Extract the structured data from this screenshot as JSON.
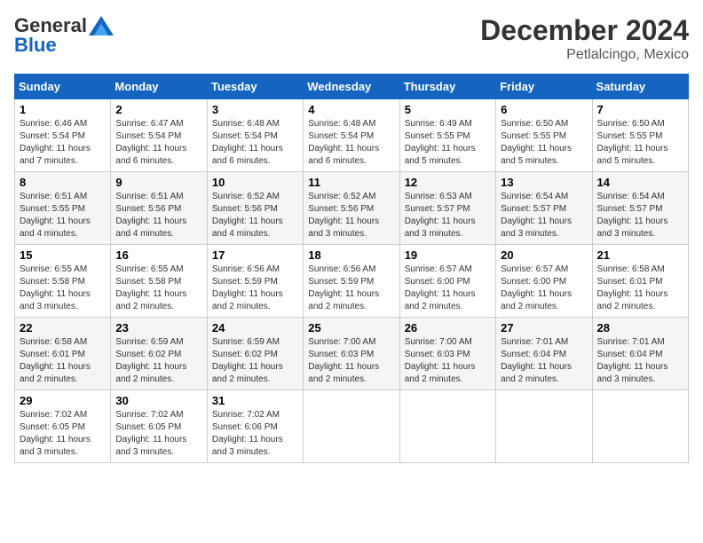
{
  "header": {
    "logo_general": "General",
    "logo_blue": "Blue",
    "month_title": "December 2024",
    "location": "Petlalcingo, Mexico"
  },
  "weekdays": [
    "Sunday",
    "Monday",
    "Tuesday",
    "Wednesday",
    "Thursday",
    "Friday",
    "Saturday"
  ],
  "weeks": [
    [
      {
        "day": "1",
        "info": "Sunrise: 6:46 AM\nSunset: 5:54 PM\nDaylight: 11 hours and 7 minutes."
      },
      {
        "day": "2",
        "info": "Sunrise: 6:47 AM\nSunset: 5:54 PM\nDaylight: 11 hours and 6 minutes."
      },
      {
        "day": "3",
        "info": "Sunrise: 6:48 AM\nSunset: 5:54 PM\nDaylight: 11 hours and 6 minutes."
      },
      {
        "day": "4",
        "info": "Sunrise: 6:48 AM\nSunset: 5:54 PM\nDaylight: 11 hours and 6 minutes."
      },
      {
        "day": "5",
        "info": "Sunrise: 6:49 AM\nSunset: 5:55 PM\nDaylight: 11 hours and 5 minutes."
      },
      {
        "day": "6",
        "info": "Sunrise: 6:50 AM\nSunset: 5:55 PM\nDaylight: 11 hours and 5 minutes."
      },
      {
        "day": "7",
        "info": "Sunrise: 6:50 AM\nSunset: 5:55 PM\nDaylight: 11 hours and 5 minutes."
      }
    ],
    [
      {
        "day": "8",
        "info": "Sunrise: 6:51 AM\nSunset: 5:55 PM\nDaylight: 11 hours and 4 minutes."
      },
      {
        "day": "9",
        "info": "Sunrise: 6:51 AM\nSunset: 5:56 PM\nDaylight: 11 hours and 4 minutes."
      },
      {
        "day": "10",
        "info": "Sunrise: 6:52 AM\nSunset: 5:56 PM\nDaylight: 11 hours and 4 minutes."
      },
      {
        "day": "11",
        "info": "Sunrise: 6:52 AM\nSunset: 5:56 PM\nDaylight: 11 hours and 3 minutes."
      },
      {
        "day": "12",
        "info": "Sunrise: 6:53 AM\nSunset: 5:57 PM\nDaylight: 11 hours and 3 minutes."
      },
      {
        "day": "13",
        "info": "Sunrise: 6:54 AM\nSunset: 5:57 PM\nDaylight: 11 hours and 3 minutes."
      },
      {
        "day": "14",
        "info": "Sunrise: 6:54 AM\nSunset: 5:57 PM\nDaylight: 11 hours and 3 minutes."
      }
    ],
    [
      {
        "day": "15",
        "info": "Sunrise: 6:55 AM\nSunset: 5:58 PM\nDaylight: 11 hours and 3 minutes."
      },
      {
        "day": "16",
        "info": "Sunrise: 6:55 AM\nSunset: 5:58 PM\nDaylight: 11 hours and 2 minutes."
      },
      {
        "day": "17",
        "info": "Sunrise: 6:56 AM\nSunset: 5:59 PM\nDaylight: 11 hours and 2 minutes."
      },
      {
        "day": "18",
        "info": "Sunrise: 6:56 AM\nSunset: 5:59 PM\nDaylight: 11 hours and 2 minutes."
      },
      {
        "day": "19",
        "info": "Sunrise: 6:57 AM\nSunset: 6:00 PM\nDaylight: 11 hours and 2 minutes."
      },
      {
        "day": "20",
        "info": "Sunrise: 6:57 AM\nSunset: 6:00 PM\nDaylight: 11 hours and 2 minutes."
      },
      {
        "day": "21",
        "info": "Sunrise: 6:58 AM\nSunset: 6:01 PM\nDaylight: 11 hours and 2 minutes."
      }
    ],
    [
      {
        "day": "22",
        "info": "Sunrise: 6:58 AM\nSunset: 6:01 PM\nDaylight: 11 hours and 2 minutes."
      },
      {
        "day": "23",
        "info": "Sunrise: 6:59 AM\nSunset: 6:02 PM\nDaylight: 11 hours and 2 minutes."
      },
      {
        "day": "24",
        "info": "Sunrise: 6:59 AM\nSunset: 6:02 PM\nDaylight: 11 hours and 2 minutes."
      },
      {
        "day": "25",
        "info": "Sunrise: 7:00 AM\nSunset: 6:03 PM\nDaylight: 11 hours and 2 minutes."
      },
      {
        "day": "26",
        "info": "Sunrise: 7:00 AM\nSunset: 6:03 PM\nDaylight: 11 hours and 2 minutes."
      },
      {
        "day": "27",
        "info": "Sunrise: 7:01 AM\nSunset: 6:04 PM\nDaylight: 11 hours and 2 minutes."
      },
      {
        "day": "28",
        "info": "Sunrise: 7:01 AM\nSunset: 6:04 PM\nDaylight: 11 hours and 3 minutes."
      }
    ],
    [
      {
        "day": "29",
        "info": "Sunrise: 7:02 AM\nSunset: 6:05 PM\nDaylight: 11 hours and 3 minutes."
      },
      {
        "day": "30",
        "info": "Sunrise: 7:02 AM\nSunset: 6:05 PM\nDaylight: 11 hours and 3 minutes."
      },
      {
        "day": "31",
        "info": "Sunrise: 7:02 AM\nSunset: 6:06 PM\nDaylight: 11 hours and 3 minutes."
      },
      {
        "day": "",
        "info": ""
      },
      {
        "day": "",
        "info": ""
      },
      {
        "day": "",
        "info": ""
      },
      {
        "day": "",
        "info": ""
      }
    ]
  ]
}
